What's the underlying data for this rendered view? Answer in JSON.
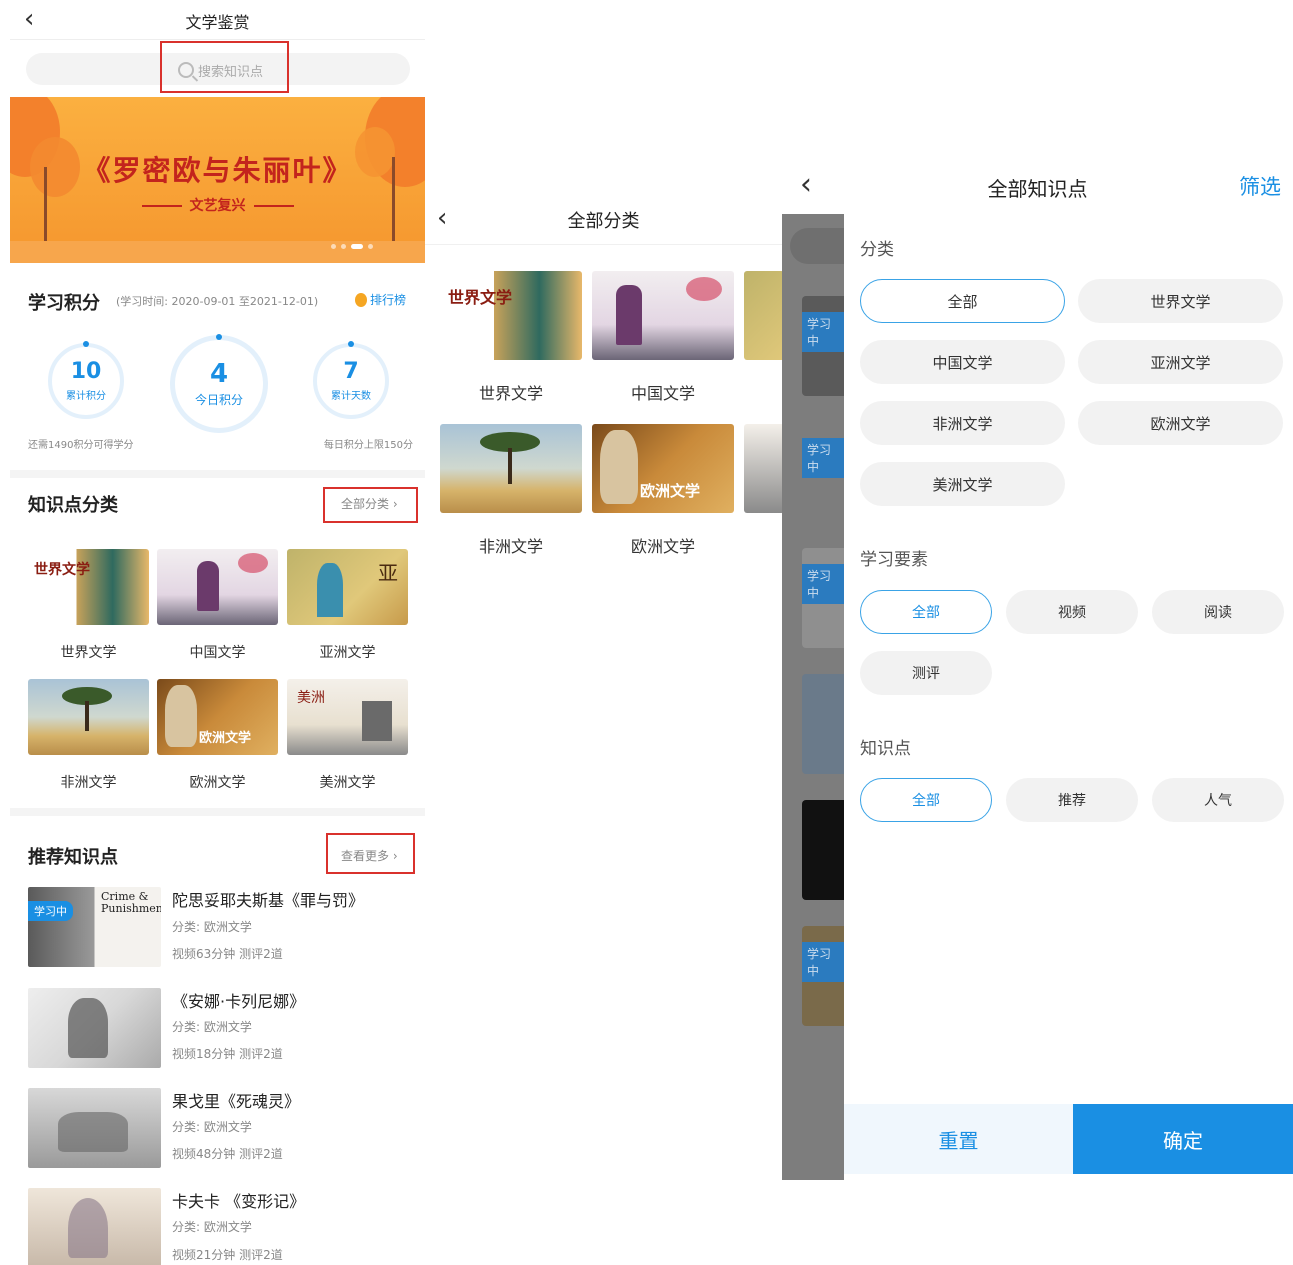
{
  "screen1": {
    "title": "文学鉴赏",
    "search_placeholder": "搜索知识点",
    "banner": {
      "title": "《罗密欧与朱丽叶》",
      "subtitle": "文艺复兴"
    },
    "points": {
      "heading": "学习积分",
      "period": "(学习时间: 2020-09-01 至2021-12-01)",
      "rank_label": "排行榜",
      "stats": [
        {
          "value": "10",
          "label": "累计积分"
        },
        {
          "value": "4",
          "label": "今日积分"
        },
        {
          "value": "7",
          "label": "累计天数"
        }
      ],
      "note_left": "还需1490积分可得学分",
      "note_right": "每日积分上限150分"
    },
    "categories": {
      "heading": "知识点分类",
      "more": "全部分类 ›",
      "items": [
        "世界文学",
        "中国文学",
        "亚洲文学",
        "非洲文学",
        "欧洲文学",
        "美洲文学"
      ]
    },
    "recommended": {
      "heading": "推荐知识点",
      "more": "查看更多 ›",
      "badge": "学习中",
      "items": [
        {
          "title": "陀思妥耶夫斯基《罪与罚》",
          "category": "分类: 欧洲文学",
          "meta": "视频63分钟 测评2道",
          "cover_text": "Crime & Punishment"
        },
        {
          "title": "《安娜·卡列尼娜》",
          "category": "分类: 欧洲文学",
          "meta": "视频18分钟 测评2道"
        },
        {
          "title": "果戈里《死魂灵》",
          "category": "分类: 欧洲文学",
          "meta": "视频48分钟 测评2道"
        },
        {
          "title": "卡夫卡 《变形记》",
          "category": "分类: 欧洲文学",
          "meta": "视频21分钟 测评2道"
        }
      ]
    }
  },
  "screen2": {
    "title": "全部分类",
    "items": [
      "世界文学",
      "中国文学",
      "非洲文学",
      "欧洲文学"
    ],
    "thumb_text": {
      "world": "世界文学",
      "europe": "欧洲文学"
    }
  },
  "screen3": {
    "title": "全部知识点",
    "filter": "筛选",
    "groups": [
      {
        "title": "分类",
        "options": [
          "全部",
          "世界文学",
          "中国文学",
          "亚洲文学",
          "非洲文学",
          "欧洲文学",
          "美洲文学"
        ]
      },
      {
        "title": "学习要素",
        "options": [
          "全部",
          "视频",
          "阅读",
          "测评"
        ]
      },
      {
        "title": "知识点",
        "options": [
          "全部",
          "推荐",
          "人气"
        ]
      }
    ],
    "bg_badge": "学习中",
    "reset": "重置",
    "confirm": "确定"
  },
  "colors": {
    "accent": "#1a8fe3",
    "highlight_box": "#d9312c",
    "banner": "#f5962e"
  }
}
